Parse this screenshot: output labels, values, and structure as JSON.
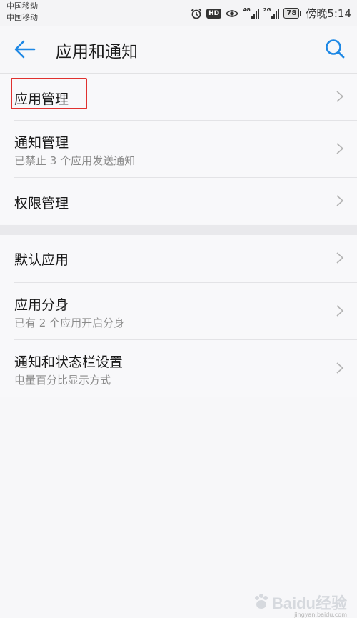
{
  "status_bar": {
    "carrier_1": "中国移动",
    "carrier_2": "中国移动",
    "hd": "HD",
    "net_1": "4G",
    "net_2": "2G",
    "battery": "78",
    "time": "傍晚5:14",
    "icons": [
      "alarm-icon",
      "eye-icon",
      "signal-icon",
      "battery-icon"
    ]
  },
  "app_bar": {
    "title": "应用和通知",
    "back_icon": "arrow-left",
    "search_icon": "magnifier",
    "accent_color": "#1e88e5"
  },
  "list": {
    "group_1": [
      {
        "label": "应用管理",
        "subtitle": ""
      },
      {
        "label": "通知管理",
        "subtitle": "已禁止 3 个应用发送通知"
      },
      {
        "label": "权限管理",
        "subtitle": ""
      }
    ],
    "group_2": [
      {
        "label": "默认应用",
        "subtitle": ""
      },
      {
        "label": "应用分身",
        "subtitle": "已有 2 个应用开启分身"
      },
      {
        "label": "通知和状态栏设置",
        "subtitle": "电量百分比显示方式"
      }
    ],
    "highlight_color": "#e0312f"
  },
  "watermark": {
    "text": "Baidu经验",
    "url": "jingyan.baidu.com"
  }
}
